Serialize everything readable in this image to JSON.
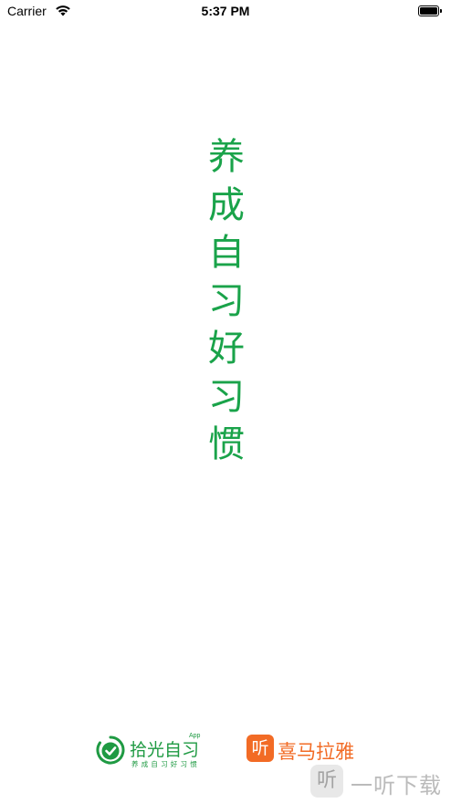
{
  "status_bar": {
    "carrier": "Carrier",
    "time": "5:37 PM",
    "wifi_icon": "wifi-icon",
    "battery_icon": "battery-icon",
    "battery_level": 1.0
  },
  "splash": {
    "slogan_chars": [
      "养",
      "成",
      "自",
      "习",
      "好",
      "习",
      "惯"
    ],
    "slogan_color": "#1aa34a"
  },
  "footer": {
    "shiguang": {
      "icon": "check-circle-icon",
      "name": "拾光自习",
      "app_label": "App",
      "tagline": "养成自习好习惯",
      "color": "#1f9a43"
    },
    "ximalaya": {
      "icon_glyph": "听",
      "name": "喜马拉雅",
      "color": "#f26b25"
    }
  },
  "watermark": {
    "icon_glyph": "听",
    "text": "一听下载"
  }
}
